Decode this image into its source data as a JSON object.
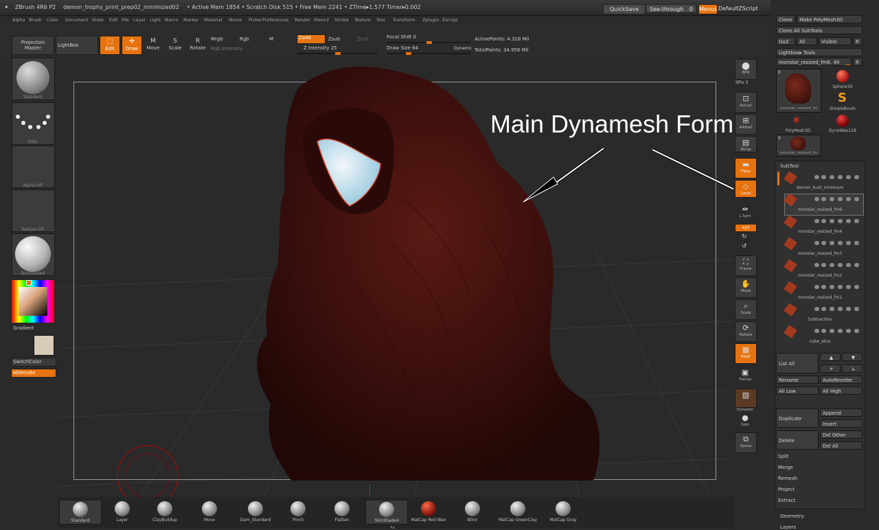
{
  "title": {
    "app": "ZBrush 4R6 P2",
    "doc": "demon_trophy_print_prep02_minimized02",
    "stats": "• Active Mem 1854 • Scratch Disk 515 • Free Mem 2241 • ZTime▸1.577 Timer▸0.002",
    "quicksave": "QuickSave",
    "seethrough": "See-through",
    "seethrough_value": "0",
    "menus": "Menus",
    "script": "DefaultZScript"
  },
  "menubar": [
    "Alpha",
    "Brush",
    "Color",
    "Document",
    "Draw",
    "Edit",
    "File",
    "Layer",
    "Light",
    "Macro",
    "Marker",
    "Material",
    "Movie",
    "Picker",
    "Preferences",
    "Render",
    "Stencil",
    "Stroke",
    "Texture",
    "Tool",
    "Transform",
    "Zplugin",
    "Zscript"
  ],
  "shelf": {
    "projection": "Projection Master",
    "lightbox": "LightBox",
    "edit": "Edit",
    "draw": "Draw",
    "move": "Move",
    "scale": "Scale",
    "rotate": "Rotate",
    "mrgb": "Mrgb",
    "rgb": "Rgb",
    "m": "M",
    "zadd": "Zadd",
    "zsub": "Zsub",
    "zcut": "Zcut",
    "rgb_intensity": "Rgb Intensity",
    "z_intensity": "Z Intensity 25",
    "focal_shift": "Focal Shift 0",
    "draw_size": "Draw Size 64",
    "dynamic": "Dynamic",
    "active_points": "ActivePoints: 4.318 Mil",
    "total_points": "TotalPoints: 34.956 Mil"
  },
  "left": {
    "brush": "Standard",
    "stroke": "Dots",
    "alpha": "Alpha  Off",
    "texture": "Texture  Off",
    "material": "SkinShade4",
    "gradient": "Gradient",
    "switchcolor": "SwitchColor",
    "alternate": "Alternate"
  },
  "annotation": "Main Dynamesh Form",
  "righttools": {
    "bpr": "BPR",
    "spix": "SPix 3",
    "actual": "Actual",
    "aahalf": "AAHalf",
    "persp": "Persp",
    "floor": "Floor",
    "local": "Local",
    "lsym": "L.Sym",
    "xyz": "xyz",
    "frame": "Frame",
    "move": "Move",
    "scale": "Scale",
    "rotate": "Rotate",
    "polyf": "PolyF",
    "transp": "Transp",
    "dynamic": "Dynamic",
    "solo": "Solo",
    "xpose": "Xpose"
  },
  "tool": {
    "clone": "Clone",
    "make_polymesh": "Make PolyMesh3D",
    "clone_all": "Clone  All SubTools",
    "goz": "GoZ",
    "all": "All",
    "visible": "Visible",
    "r": "R",
    "lightbox_tools": "Lightbox▸ Tools",
    "current": "monstar_resized_fm6. 49",
    "thumbs": [
      "monstar_resized_fm",
      "Sphere3D",
      "SimpleBrush",
      "PolyMesh3D",
      "DynaWax128",
      "monstar_resized_fm"
    ],
    "thumb_counts": [
      "8",
      "8"
    ]
  },
  "subtool": {
    "header": "SubTool",
    "items": [
      "demon_bust_minimum",
      "monstar_resized_fm6",
      "monstar_resized_fm4",
      "monstar_resized_fm3",
      "monstar_resized_fm2",
      "monstar_resized_fm1",
      "Subtraction",
      "cube_slice"
    ],
    "list_all": "List  All",
    "rename": "Rename",
    "autoreorder": "AutoReorder",
    "all_low": "All  Low",
    "all_high": "All  High",
    "duplicate": "Duplicate",
    "append": "Append",
    "insert": "Insert",
    "delete": "Delete",
    "del_other": "Del  Other",
    "del_all": "Del  All",
    "split": "Split",
    "merge": "Merge",
    "remesh": "Remesh",
    "project": "Project",
    "extract": "Extract",
    "geometry": "Geometry",
    "layers": "Layers"
  },
  "bottom": [
    "Standard",
    "Layer",
    "ClayBuildup",
    "Move",
    "Dam_Standard",
    "Pinch",
    "Flatten",
    "SkinShade4",
    "MatCap  Red  Wax",
    "Blinn",
    "MatCap  GreenClay",
    "MatCap  Gray"
  ],
  "colors": {
    "accent": "#e6730f",
    "bg": "#2a2a2a",
    "model": "#3a0f0c"
  }
}
